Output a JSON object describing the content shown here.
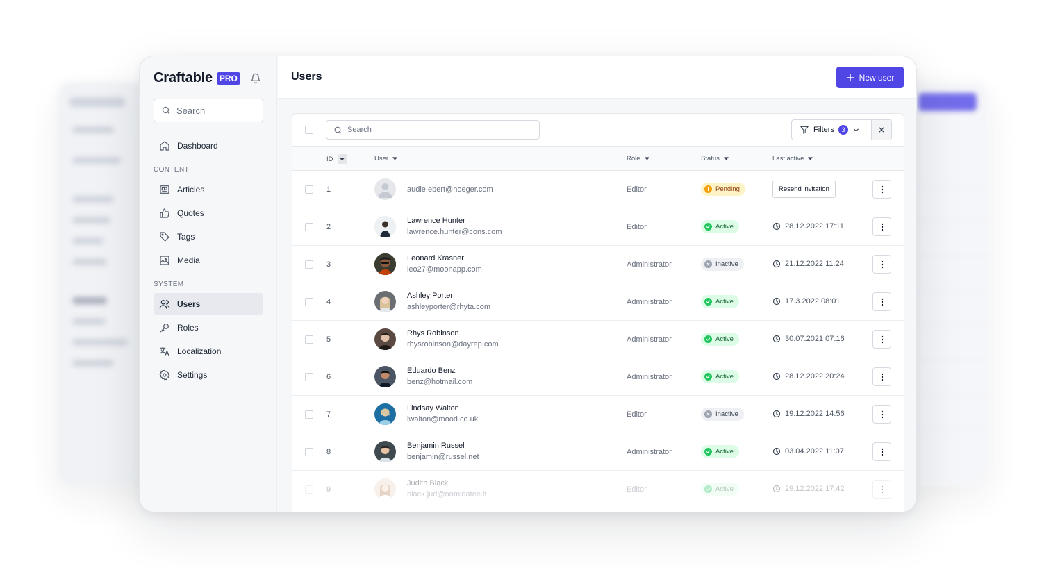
{
  "app": {
    "brand_name": "Craftable",
    "brand_badge": "PRO",
    "accent_color": "#4f46e5"
  },
  "sidebar": {
    "search_placeholder": "Search",
    "dashboard_label": "Dashboard",
    "sections": {
      "content": "CONTENT",
      "system": "SYSTEM"
    },
    "content_items": [
      {
        "label": "Articles",
        "icon": "articles-icon"
      },
      {
        "label": "Quotes",
        "icon": "thumb-up-icon"
      },
      {
        "label": "Tags",
        "icon": "tag-icon"
      },
      {
        "label": "Media",
        "icon": "image-icon"
      }
    ],
    "system_items": [
      {
        "label": "Users",
        "icon": "users-icon",
        "active": true
      },
      {
        "label": "Roles",
        "icon": "key-icon"
      },
      {
        "label": "Localization",
        "icon": "translate-icon"
      },
      {
        "label": "Settings",
        "icon": "gear-icon"
      }
    ]
  },
  "header": {
    "title": "Users",
    "new_user_label": "New user"
  },
  "table": {
    "search_placeholder": "Search",
    "filters_label": "Filters",
    "filters_count": "3",
    "columns": {
      "id": "ID",
      "user": "User",
      "role": "Role",
      "status": "Status",
      "last_active": "Last active"
    },
    "resend_label": "Resend invitation",
    "rows": [
      {
        "id": "1",
        "name": "",
        "email": "audie.ebert@hoeger.com",
        "role": "Editor",
        "status": "Pending",
        "last_active": ""
      },
      {
        "id": "2",
        "name": "Lawrence Hunter",
        "email": "lawrence.hunter@cons.com",
        "role": "Editor",
        "status": "Active",
        "last_active": "28.12.2022 17:11"
      },
      {
        "id": "3",
        "name": "Leonard Krasner",
        "email": "leo27@moonapp.com",
        "role": "Administrator",
        "status": "Inactive",
        "last_active": "21.12.2022 11:24"
      },
      {
        "id": "4",
        "name": "Ashley Porter",
        "email": "ashleyporter@rhyta.com",
        "role": "Administrator",
        "status": "Active",
        "last_active": "17.3.2022 08:01"
      },
      {
        "id": "5",
        "name": "Rhys Robinson",
        "email": "rhysrobinson@dayrep.com",
        "role": "Administrator",
        "status": "Active",
        "last_active": "30.07.2021 07:16"
      },
      {
        "id": "6",
        "name": "Eduardo Benz",
        "email": "benz@hotmail.com",
        "role": "Administrator",
        "status": "Active",
        "last_active": "28.12.2022 20:24"
      },
      {
        "id": "7",
        "name": "Lindsay Walton",
        "email": "lwalton@mood.co.uk",
        "role": "Editor",
        "status": "Inactive",
        "last_active": "19.12.2022 14:56"
      },
      {
        "id": "8",
        "name": "Benjamin Russel",
        "email": "benjamin@russel.net",
        "role": "Administrator",
        "status": "Active",
        "last_active": "03.04.2022 11:07"
      },
      {
        "id": "9",
        "name": "Judith Black",
        "email": "black.jud@nominatee.it",
        "role": "Editor",
        "status": "Active",
        "last_active": "29.12.2022 17:42"
      }
    ]
  }
}
